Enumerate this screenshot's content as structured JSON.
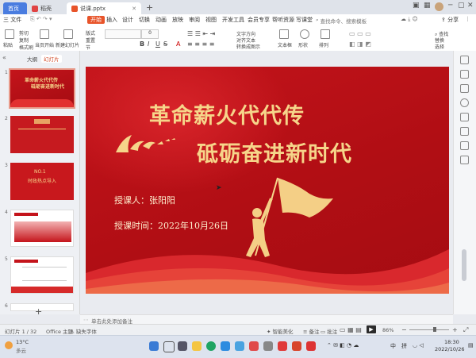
{
  "tabs": {
    "home": "首页",
    "straw": "稻壳",
    "active_file": "说课.pptx",
    "new_tab": "+"
  },
  "menu": {
    "file": "三 文件",
    "items": [
      "开始",
      "插入",
      "设计",
      "切换",
      "动画",
      "放映",
      "审阅",
      "视图",
      "开发工具",
      "会员专享",
      "帮听资源",
      "写课堂"
    ],
    "search_placeholder": "查找命令、搜索模板",
    "share": "分享"
  },
  "ribbon": {
    "paste": "粘贴",
    "cut": "剪切",
    "copy": "复制",
    "format_painter": "格式刷",
    "start_from_current": "当页开始",
    "new_slide": "新建幻灯片",
    "layout": "版式",
    "reset": "重置",
    "section": "节",
    "font_size": "0",
    "bold": "B",
    "italic": "I",
    "underline": "U",
    "strike": "S",
    "textbox": "文本框",
    "shape": "形状",
    "arrange": "排列",
    "find": "查找",
    "replace": "替换",
    "select": "选择",
    "convert_smartart": "转换成图示",
    "arrange_text": "文字方向",
    "align_text": "对齐文本"
  },
  "left_panel": {
    "tab_outline": "大纲",
    "tab_slides": "幻灯片",
    "add_slide": "+",
    "slide_numbers": [
      "1",
      "2",
      "3",
      "4",
      "5",
      "6"
    ]
  },
  "slide": {
    "title_line1": "革命薪火代代传",
    "title_line2": "砥砺奋进新时代",
    "lecturer": "授课人：张阳阳",
    "time": "授课时间：2022年10月26日"
  },
  "thumbs": {
    "t1_title": "革命薪火代代传",
    "t1_sub": "砥砺奋进新时代",
    "t3_title": "NO.1",
    "t3_sub": "时政热点导入"
  },
  "notes": {
    "placeholder": "单击此处添加备注"
  },
  "status": {
    "slide_count": "幻灯片 1 / 32",
    "theme": "Office 主题",
    "missing_font": "缺失字体",
    "smart_beautify": "智能美化",
    "notes_btn": "备注",
    "comment_btn": "批注",
    "zoom": "86%"
  },
  "taskbar": {
    "weather_temp": "13°C",
    "weather_desc": "多云",
    "ime": "中",
    "ime2": "拼",
    "time": "18:30",
    "date": "2022/10/26"
  },
  "colors": {
    "slide_red": "#c4141b",
    "title_gold": "#f6d58a",
    "accent_orange": "#e8542a",
    "home_tab_blue": "#4a7de0"
  }
}
